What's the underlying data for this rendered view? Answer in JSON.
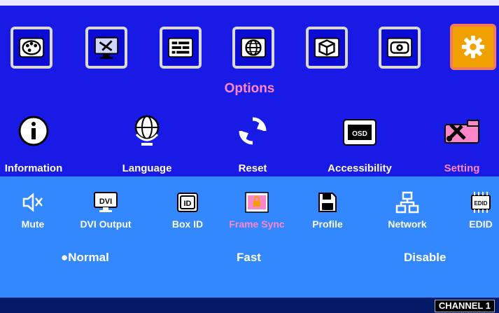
{
  "tabs": [
    {
      "icon": "palette-icon",
      "active": false
    },
    {
      "icon": "monitor-tools-icon",
      "active": false
    },
    {
      "icon": "equalizer-icon",
      "active": false
    },
    {
      "icon": "globe-icon",
      "active": false
    },
    {
      "icon": "cube-3d-icon",
      "active": false
    },
    {
      "icon": "projector-icon",
      "active": false
    },
    {
      "icon": "gear-icon",
      "active": true
    }
  ],
  "section_title": "Options",
  "menu": {
    "items": [
      {
        "label": "Information",
        "icon": "info-icon"
      },
      {
        "label": "Language",
        "icon": "globe-stand-icon"
      },
      {
        "label": "Reset",
        "icon": "reset-icon"
      },
      {
        "label": "Accessibility",
        "icon": "osd-icon"
      },
      {
        "label": "Setting",
        "icon": "setting-tools-icon"
      }
    ]
  },
  "submenu": {
    "items": [
      {
        "label": "Mute",
        "icon": "speaker-mute-icon"
      },
      {
        "label": "DVI Output",
        "icon": "dvi-monitor-icon"
      },
      {
        "label": "Box ID",
        "icon": "id-icon"
      },
      {
        "label": "Frame Sync",
        "icon": "frame-lock-icon"
      },
      {
        "label": "Profile",
        "icon": "floppy-disk-icon"
      },
      {
        "label": "Network",
        "icon": "network-icon"
      },
      {
        "label": "EDID",
        "icon": "edid-chip-icon"
      }
    ]
  },
  "options": {
    "normal": "●Normal",
    "fast": "Fast",
    "disable": "Disable"
  },
  "status": {
    "channel": "CHANNEL 1"
  },
  "colors": {
    "background": "#1a1ae6",
    "highlight": "#ff86c8",
    "submenu_bg": "#3388ff",
    "active_tab": "#f0a000"
  }
}
